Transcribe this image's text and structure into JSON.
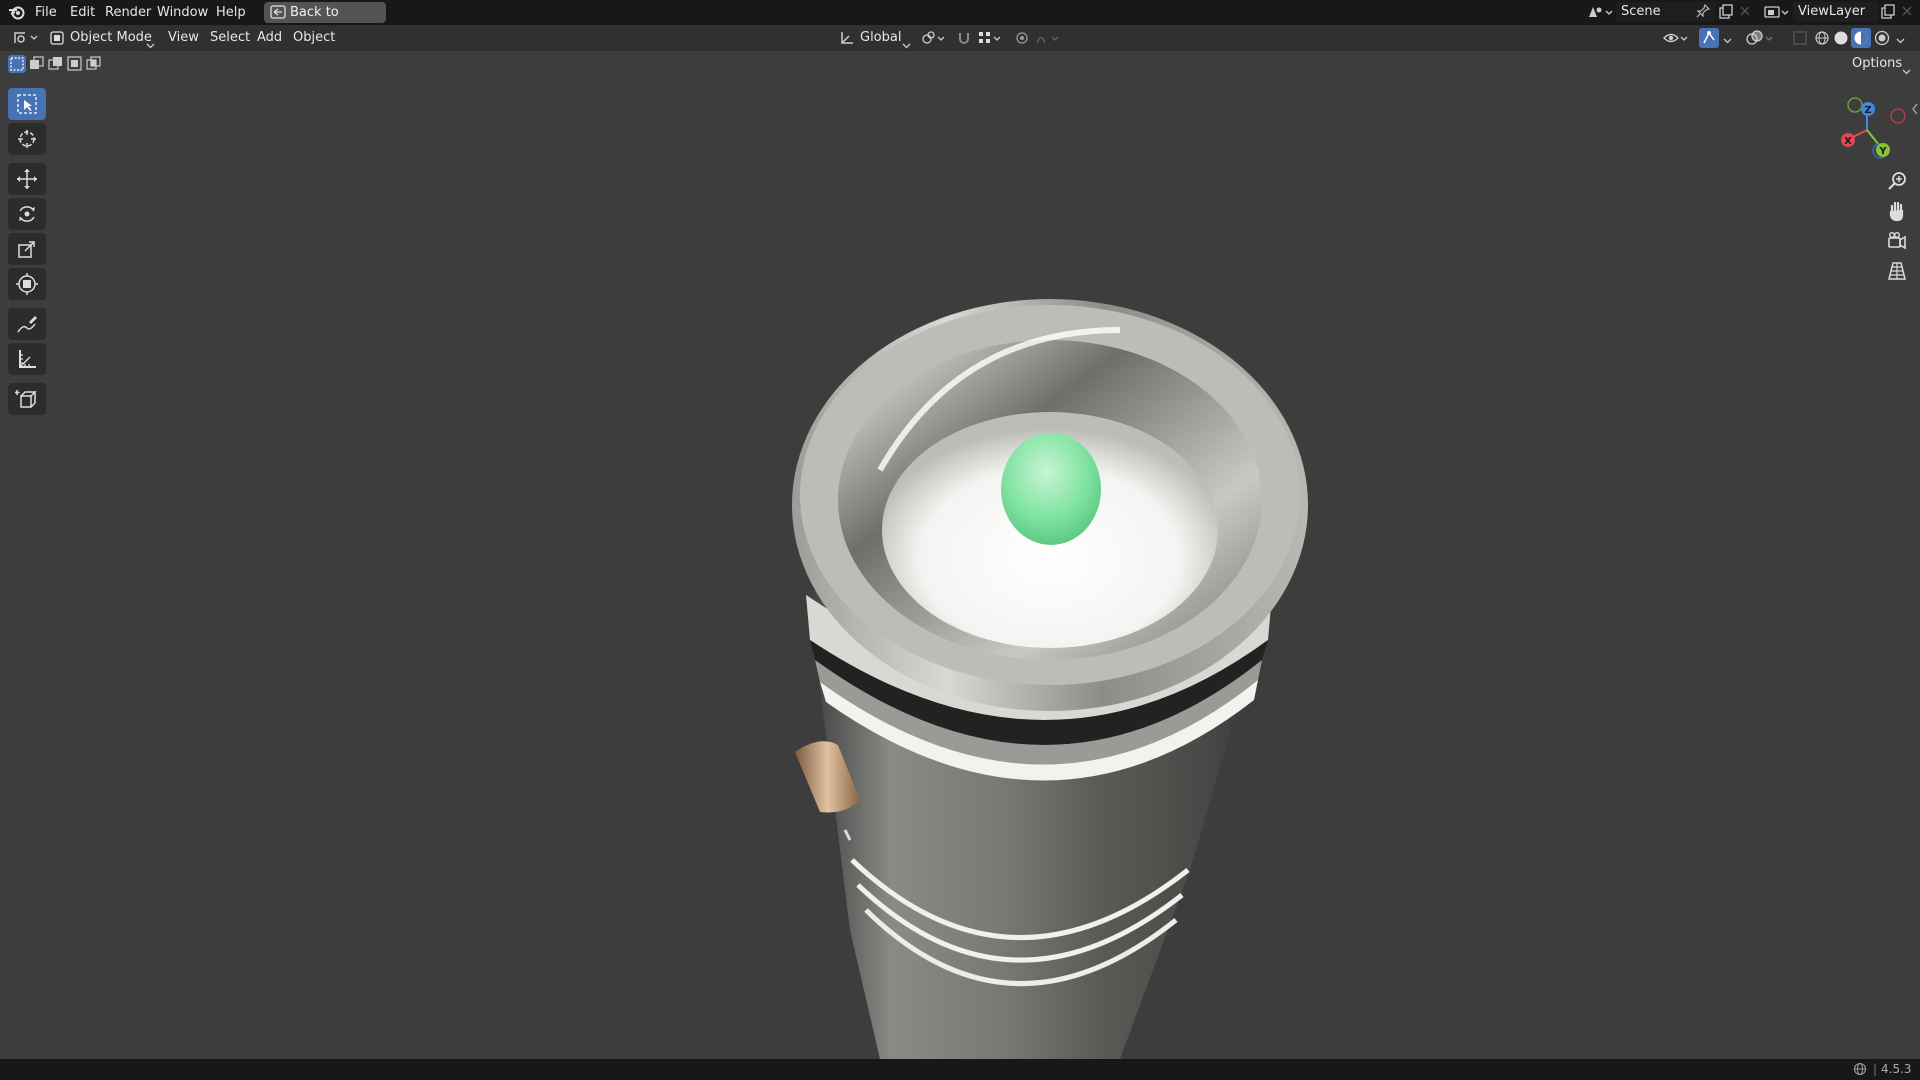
{
  "topbar": {
    "menus": [
      "File",
      "Edit",
      "Render",
      "Window",
      "Help"
    ],
    "back_label": "Back to Previous",
    "scene_label": "Scene",
    "viewlayer_label": "ViewLayer"
  },
  "viewport_header": {
    "mode_label": "Object Mode",
    "menus": [
      "View",
      "Select",
      "Add",
      "Object"
    ],
    "orientation_label": "Global",
    "options_label": "Options"
  },
  "gizmo": {
    "x_label": "X",
    "y_label": "Y",
    "z_label": "Z"
  },
  "colors": {
    "accent": "#4772b3",
    "axis_x": "#e04a56",
    "axis_y": "#86c23c",
    "axis_z": "#3d8be0",
    "background": "#3d3d3d"
  },
  "statusbar": {
    "version": "4.5.3"
  }
}
